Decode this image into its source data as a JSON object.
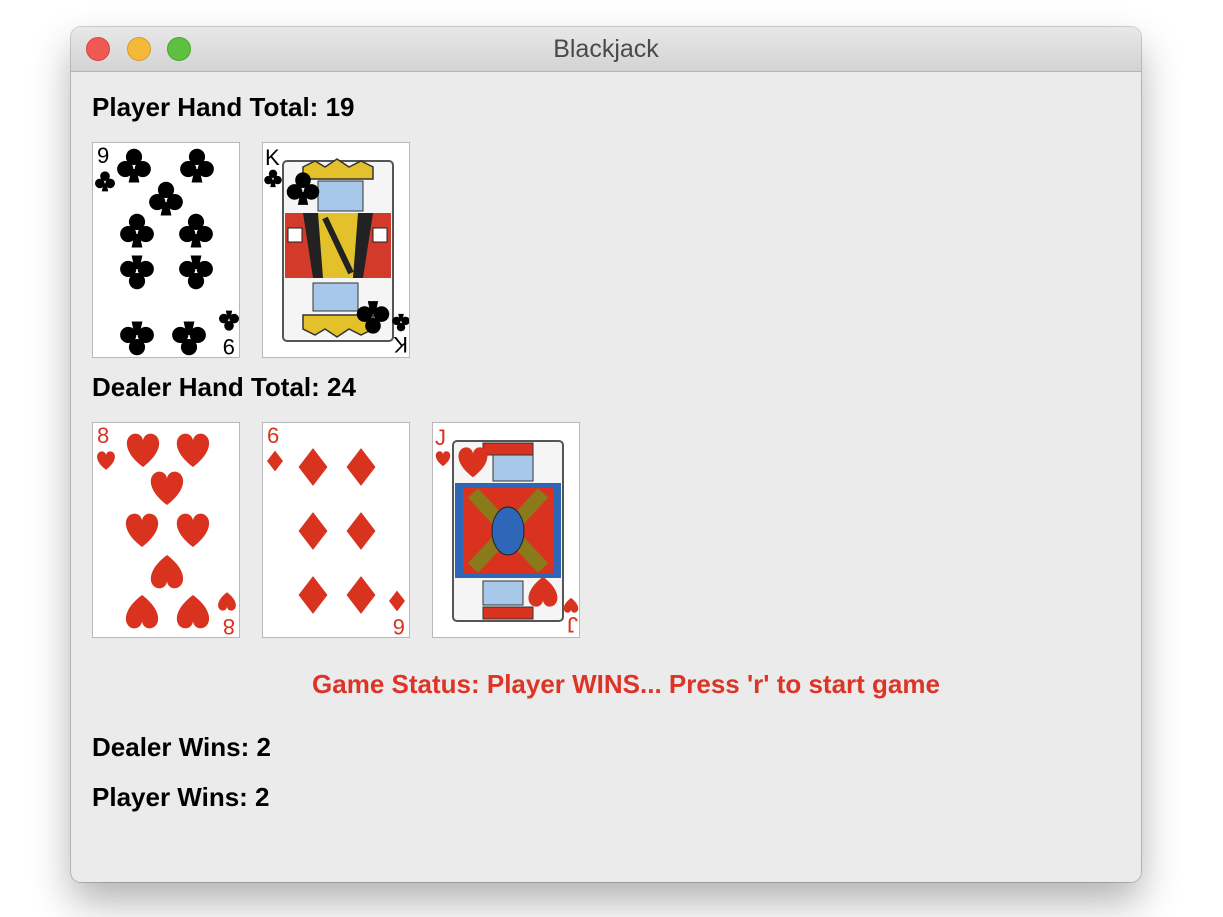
{
  "window": {
    "title": "Blackjack"
  },
  "player": {
    "label": "Player Hand Total: 19",
    "cards": [
      {
        "rank": "9",
        "suit": "clubs"
      },
      {
        "rank": "K",
        "suit": "clubs"
      }
    ]
  },
  "dealer": {
    "label": "Dealer Hand Total: 24",
    "cards": [
      {
        "rank": "8",
        "suit": "hearts"
      },
      {
        "rank": "6",
        "suit": "diamonds"
      },
      {
        "rank": "J",
        "suit": "hearts"
      }
    ]
  },
  "status": {
    "text": "Game Status: Player WINS... Press 'r' to start game",
    "color": "#dd3427"
  },
  "scores": {
    "dealer_wins": "Dealer Wins: 2",
    "player_wins": "Player Wins: 2"
  }
}
